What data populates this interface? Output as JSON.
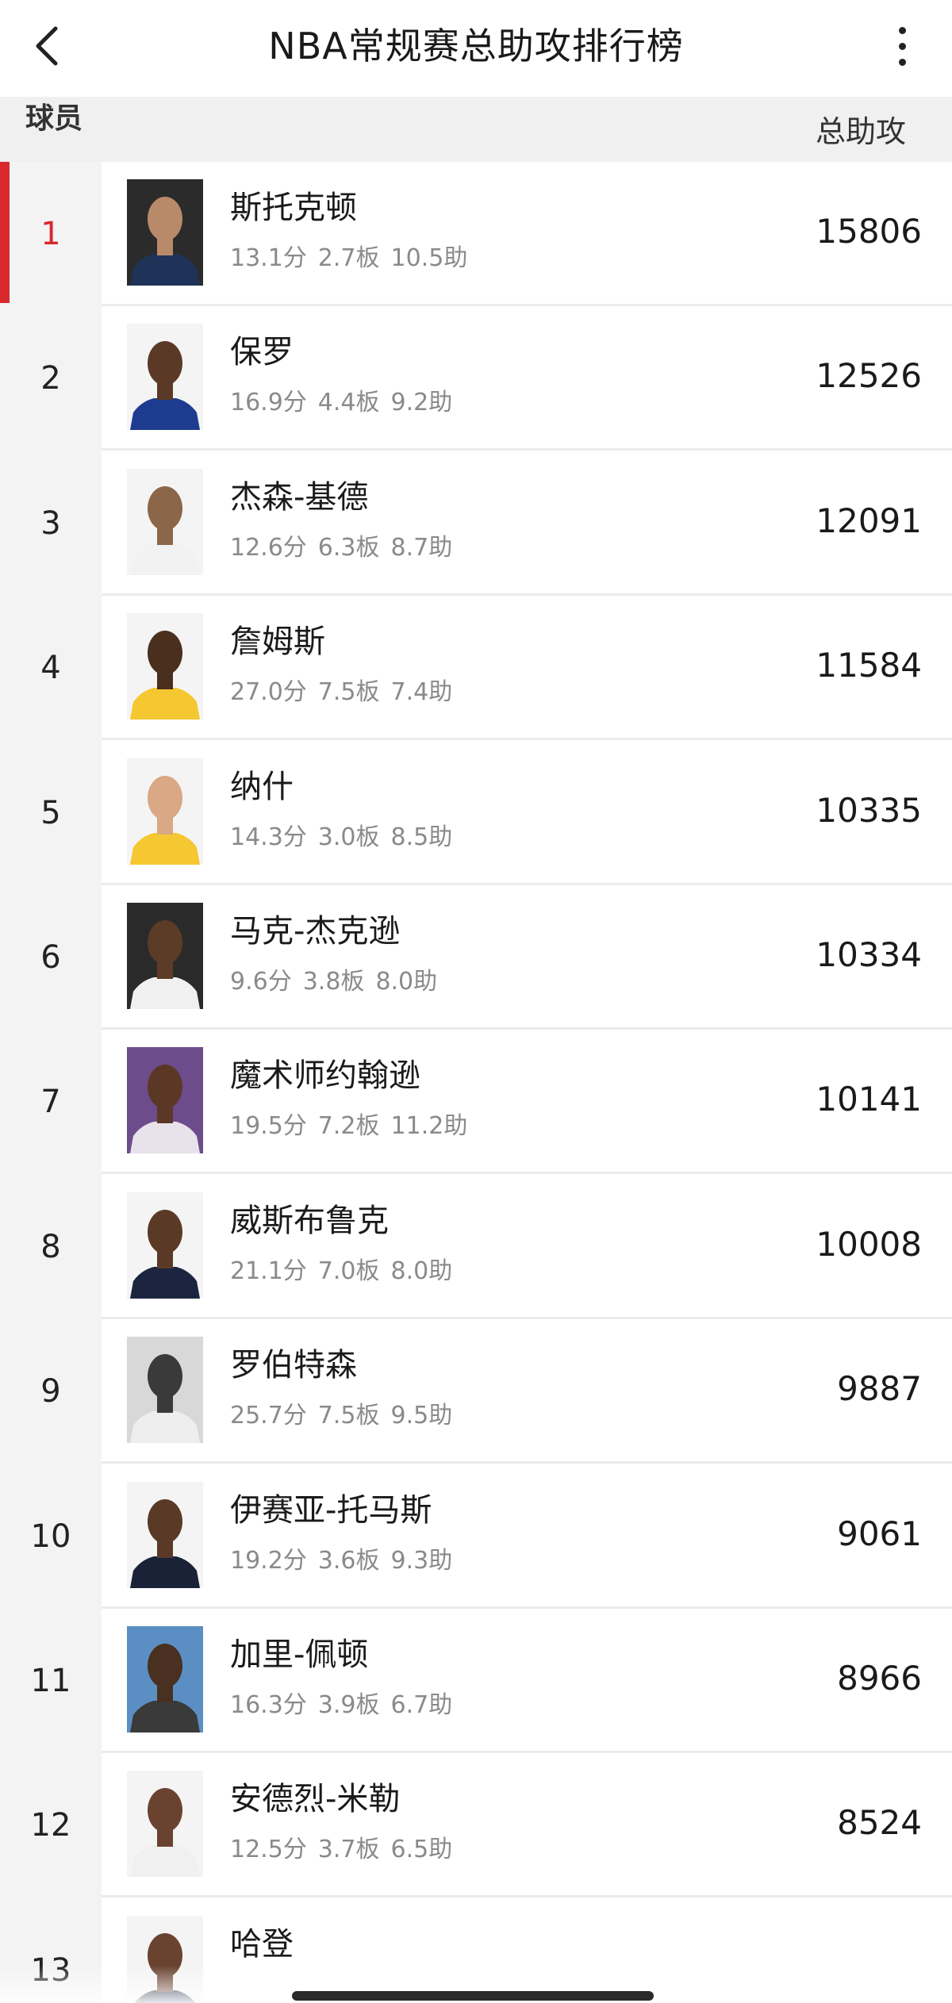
{
  "header": {
    "title": "NBA常规赛总助攻排行榜",
    "back_icon": "chevron-left-icon",
    "more_icon": "more-vertical-icon"
  },
  "columns": {
    "player": "球员",
    "total_assists": "总助攻"
  },
  "accent_color": "#d9282e",
  "players": [
    {
      "rank": "1",
      "name": "斯托克顿",
      "pts": "13.1分",
      "reb": "2.7板",
      "ast": "10.5助",
      "total": "15806",
      "jersey": "#1f3358",
      "skin": "#b98a6a",
      "bg": "#2b2b2b"
    },
    {
      "rank": "2",
      "name": "保罗",
      "pts": "16.9分",
      "reb": "4.4板",
      "ast": "9.2助",
      "total": "12526",
      "jersey": "#1d3c8f",
      "skin": "#5a3a26",
      "bg": "#f4f4f4"
    },
    {
      "rank": "3",
      "name": "杰森-基德",
      "pts": "12.6分",
      "reb": "6.3板",
      "ast": "8.7助",
      "total": "12091",
      "jersey": "#f2f2f2",
      "skin": "#8c6648",
      "bg": "#f4f4f4"
    },
    {
      "rank": "4",
      "name": "詹姆斯",
      "pts": "27.0分",
      "reb": "7.5板",
      "ast": "7.4助",
      "total": "11584",
      "jersey": "#f5c730",
      "skin": "#4a2f1e",
      "bg": "#f4f4f4"
    },
    {
      "rank": "5",
      "name": "纳什",
      "pts": "14.3分",
      "reb": "3.0板",
      "ast": "8.5助",
      "total": "10335",
      "jersey": "#f5c730",
      "skin": "#d9a884",
      "bg": "#f4f4f4"
    },
    {
      "rank": "6",
      "name": "马克-杰克逊",
      "pts": "9.6分",
      "reb": "3.8板",
      "ast": "8.0助",
      "total": "10334",
      "jersey": "#f0f0f0",
      "skin": "#5c3b27",
      "bg": "#2a2a2a"
    },
    {
      "rank": "7",
      "name": "魔术师约翰逊",
      "pts": "19.5分",
      "reb": "7.2板",
      "ast": "11.2助",
      "total": "10141",
      "jersey": "#e8e2ea",
      "skin": "#5a3825",
      "bg": "#6d4c8c"
    },
    {
      "rank": "8",
      "name": "威斯布鲁克",
      "pts": "21.1分",
      "reb": "7.0板",
      "ast": "8.0助",
      "total": "10008",
      "jersey": "#1b2540",
      "skin": "#5a3a26",
      "bg": "#f4f4f4"
    },
    {
      "rank": "9",
      "name": "罗伯特森",
      "pts": "25.7分",
      "reb": "7.5板",
      "ast": "9.5助",
      "total": "9887",
      "jersey": "#eeeeee",
      "skin": "#3a3a3a",
      "bg": "#d8d8d8"
    },
    {
      "rank": "10",
      "name": "伊赛亚-托马斯",
      "pts": "19.2分",
      "reb": "3.6板",
      "ast": "9.3助",
      "total": "9061",
      "jersey": "#1a2238",
      "skin": "#5a3a26",
      "bg": "#f4f4f4"
    },
    {
      "rank": "11",
      "name": "加里-佩顿",
      "pts": "16.3分",
      "reb": "3.9板",
      "ast": "6.7助",
      "total": "8966",
      "jersey": "#3a3a3a",
      "skin": "#4a3020",
      "bg": "#5b8fc4"
    },
    {
      "rank": "12",
      "name": "安德烈-米勒",
      "pts": "12.5分",
      "reb": "3.7板",
      "ast": "6.5助",
      "total": "8524",
      "jersey": "#f0f0f0",
      "skin": "#6a4330",
      "bg": "#f4f4f4"
    },
    {
      "rank": "13",
      "name": "哈登",
      "pts": "",
      "reb": "",
      "ast": "",
      "total": "",
      "jersey": "#1b2540",
      "skin": "#6a4330",
      "bg": "#f4f4f4"
    }
  ]
}
